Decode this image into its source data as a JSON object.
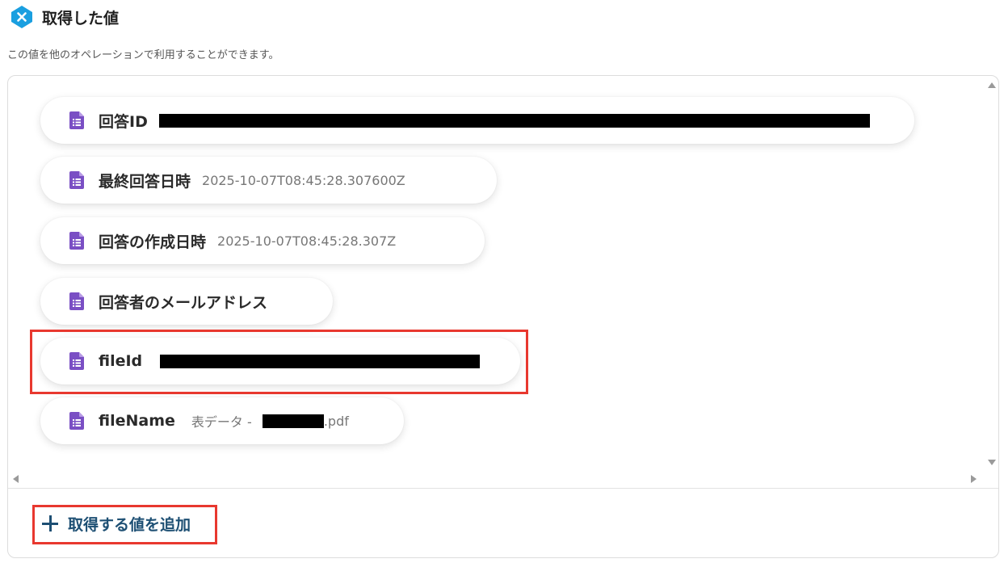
{
  "header": {
    "title": "取得した値",
    "logo_icon": "yoom-logo-icon",
    "logo_color": "#1a9fe0"
  },
  "subtitle": "この値を他のオペレーションで利用することができます。",
  "fields": [
    {
      "label": "回答ID",
      "value": "",
      "redacted": true,
      "icon": "google-forms-doc-icon"
    },
    {
      "label": "最終回答日時",
      "value": "2025-10-07T08:45:28.307600Z",
      "icon": "google-forms-doc-icon"
    },
    {
      "label": "回答の作成日時",
      "value": "2025-10-07T08:45:28.307Z",
      "icon": "google-forms-doc-icon"
    },
    {
      "label": "回答者のメールアドレス",
      "value": "",
      "icon": "google-forms-doc-icon"
    },
    {
      "label": "fileId",
      "value": "",
      "redacted": true,
      "icon": "google-forms-doc-icon"
    },
    {
      "label": "fileName",
      "value_prefix": "表データ - ",
      "value_suffix": ".pdf",
      "redacted_middle": true,
      "icon": "google-forms-doc-icon"
    }
  ],
  "add_button": {
    "label": "取得する値を追加",
    "icon": "plus-icon"
  },
  "colors": {
    "accent": "#1d4f73",
    "icon_purple": "#7a4fc4",
    "highlight_red": "#e8382f"
  }
}
